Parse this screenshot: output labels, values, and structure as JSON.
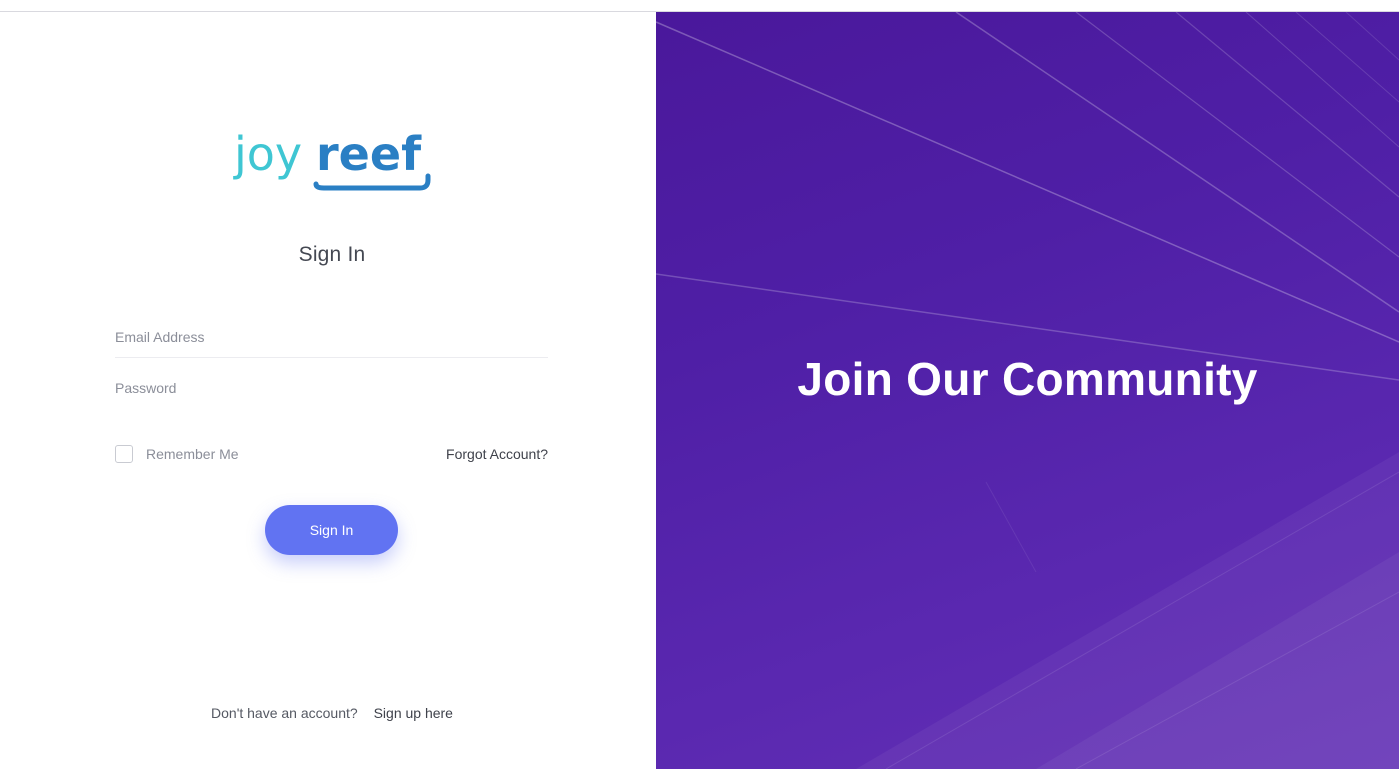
{
  "brand": {
    "logo_text_light": "joy",
    "logo_text_bold": "reef",
    "color_light": "#3fc6d3",
    "color_bold": "#2a7fc4"
  },
  "signin": {
    "title": "Sign In",
    "email_placeholder": "Email Address",
    "password_placeholder": "Password",
    "remember_label": "Remember Me",
    "forgot_label": "Forgot Account?",
    "button_label": "Sign In",
    "signup_prompt": "Don't have an account?",
    "signup_link": "Sign up here"
  },
  "hero": {
    "headline": "Join Our Community",
    "background": "#4f1fa6"
  },
  "colors": {
    "accent": "#6173f2"
  }
}
